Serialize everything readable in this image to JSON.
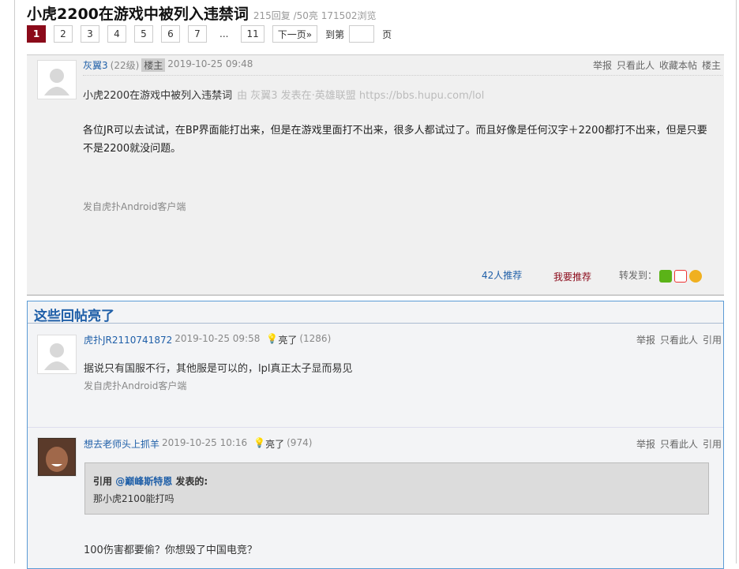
{
  "thread": {
    "title": "小虎2200在游戏中被列入违禁词",
    "meta": "215回复 /50亮  171502浏览"
  },
  "pager": {
    "pages": [
      "1",
      "2",
      "3",
      "4",
      "5",
      "6",
      "7"
    ],
    "dots": "...",
    "last": "11",
    "next": "下一页»",
    "goto_label": "到第",
    "page_label": "页"
  },
  "op": {
    "author": "灰翼3",
    "level": "(22级)",
    "badge": "楼主",
    "time": "2019-10-25 09:48",
    "actions": [
      "举报",
      "只看此人",
      "收藏本帖",
      "楼主"
    ],
    "subject": "小虎2200在游戏中被列入违禁词",
    "source": "由  灰翼3 发表在·英雄联盟 https://bbs.hupu.com/lol",
    "body": "各位JR可以去试试，在BP界面能打出来，但是在游戏里面打不出来，很多人都试过了。而且好像是任何汉字＋2200都打不出来，但是只要不是2200就没问题。",
    "client": "发自虎扑Android客户端",
    "recommend_count": "42人推荐",
    "recommend_btn": "我要推荐",
    "share_label": "转发到："
  },
  "hot": {
    "title": "这些回帖亮了",
    "replies": [
      {
        "author": "虎扑JR2110741872",
        "time": "2019-10-25 09:58",
        "light": "亮了",
        "light_count": "(1286)",
        "body": "据说只有国服不行，其他服是可以的，lpl真正太子显而易见",
        "client": "发自虎扑Android客户端",
        "actions": [
          "举报",
          "只看此人",
          "引用"
        ]
      },
      {
        "author": "想去老师头上抓羊",
        "time": "2019-10-25 10:16",
        "light": "亮了",
        "light_count": "(974)",
        "quote_prefix": "引用 ",
        "quote_user": "@巅峰斯特恩",
        "quote_suffix": " 发表的:",
        "quote_text": "那小虎2100能打吗",
        "body": "100伤害都要偷？你想毁了中国电竞？",
        "actions": [
          "举报",
          "只看此人",
          "引用"
        ]
      }
    ]
  }
}
